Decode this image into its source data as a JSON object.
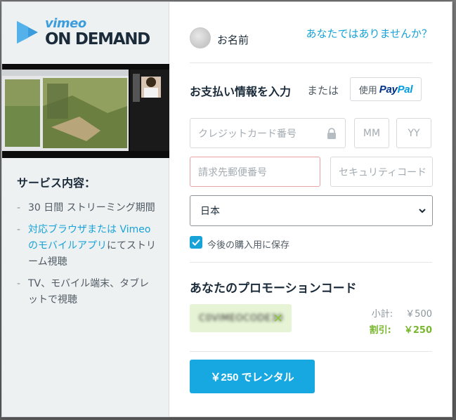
{
  "brand": {
    "vimeo": "vimeo",
    "on_demand": "ON DEMAND",
    "accent": "#3b9ddd",
    "dark": "#1b2b3a"
  },
  "services": {
    "title": "サービス内容：",
    "items": [
      {
        "text": "30 日間 ストリーミング期間"
      },
      {
        "link_text": "対応ブラウザまたは Vimeo のモバイルアプリ",
        "text": "にてストリーム視聴"
      },
      {
        "text": "TV、モバイル端末、タブレットで視聴"
      }
    ]
  },
  "user": {
    "name": "お名前",
    "not_you": "あなたではありませんか？"
  },
  "payment": {
    "title": "お支払い情報を入力",
    "or": "または",
    "paypal_use": "使用",
    "paypal_brand_a": "Pay",
    "paypal_brand_b": "Pal",
    "card_placeholder": "クレジットカード番号",
    "mm_placeholder": "MM",
    "yy_placeholder": "YY",
    "postal_placeholder": "請求先郵便番号",
    "security_placeholder": "セキュリティコード",
    "country": "日本",
    "save_label": "今後の購入用に保存",
    "save_checked": true
  },
  "promo": {
    "title": "あなたのプロモーションコード",
    "code": "C0VIMEOCODE30",
    "subtotal_label": "小計:",
    "subtotal_value": "￥500",
    "discount_label": "割引:",
    "discount_value": "￥250"
  },
  "cta": {
    "label": "￥250 でレンタル",
    "color": "#17a8e2"
  }
}
